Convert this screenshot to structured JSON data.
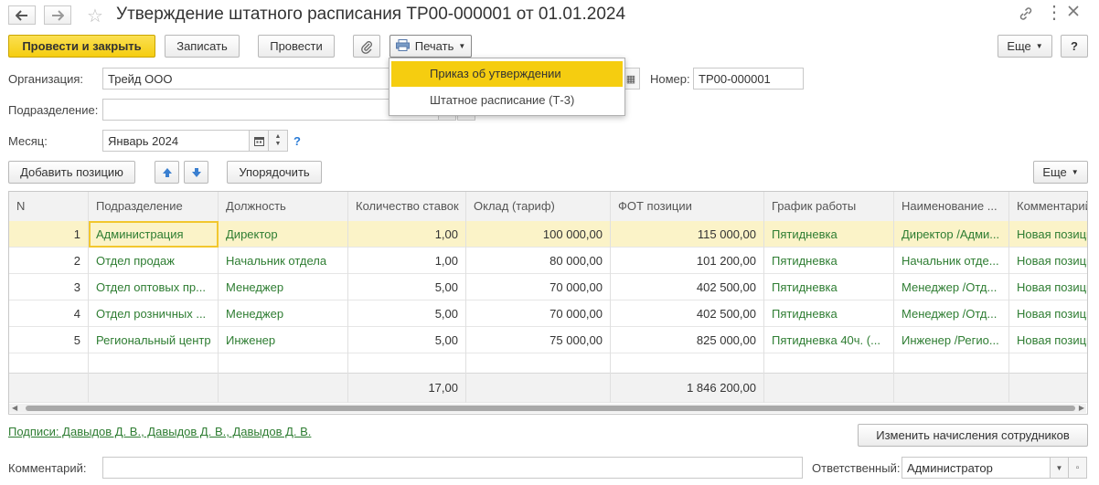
{
  "window": {
    "title": "Утверждение штатного расписания ТР00-000001 от 01.01.2024"
  },
  "toolbar": {
    "post_close": "Провести и закрыть",
    "save": "Записать",
    "post": "Провести",
    "print": "Печать",
    "more": "Еще",
    "help": "?"
  },
  "print_menu": {
    "items": [
      "Приказ об утверждении",
      "Штатное расписание (Т-3)"
    ],
    "active_index": 0
  },
  "form": {
    "org_label": "Организация:",
    "org_value": "Трейд ООО",
    "number_label": "Номер:",
    "number_value": "ТР00-000001",
    "dept_label": "Подразделение:",
    "dept_value": "",
    "month_label": "Месяц:",
    "month_value": "Январь 2024",
    "help_mark": "?"
  },
  "table_toolbar": {
    "add": "Добавить позицию",
    "sort": "Упорядочить",
    "more": "Еще"
  },
  "table": {
    "columns": [
      "N",
      "Подразделение",
      "Должность",
      "Количество ставок",
      "Оклад (тариф)",
      "ФОТ  позиции",
      "График работы",
      "Наименование ...",
      "Комментарий"
    ],
    "rows": [
      [
        "1",
        "Администрация",
        "Директор",
        "1,00",
        "100 000,00",
        "115 000,00",
        "Пятидневка",
        "Директор /Адми...",
        "Новая позиция"
      ],
      [
        "2",
        "Отдел продаж",
        "Начальник отдела",
        "1,00",
        "80 000,00",
        "101 200,00",
        "Пятидневка",
        "Начальник отде...",
        "Новая позиция"
      ],
      [
        "3",
        "Отдел оптовых пр...",
        "Менеджер",
        "5,00",
        "70 000,00",
        "402 500,00",
        "Пятидневка",
        "Менеджер /Отд...",
        "Новая позиция"
      ],
      [
        "4",
        "Отдел розничных ...",
        "Менеджер",
        "5,00",
        "70 000,00",
        "402 500,00",
        "Пятидневка",
        "Менеджер /Отд...",
        "Новая позиция"
      ],
      [
        "5",
        "Региональный центр",
        "Инженер",
        "5,00",
        "75 000,00",
        "825 000,00",
        "Пятидневка 40ч. (...",
        "Инженер /Регио...",
        "Новая позиция"
      ]
    ],
    "totals": {
      "rates": "17,00",
      "fot": "1 846 200,00"
    }
  },
  "bottom": {
    "signatures_link": "Подписи: Давыдов Д. В., Давыдов Д. В., Давыдов Д. В.",
    "change_accruals": "Изменить начисления сотрудников",
    "comment_label": "Комментарий:",
    "comment_value": "",
    "responsible_label": "Ответственный:",
    "responsible_value": "Администратор"
  },
  "colors": {
    "accent_yellow": "#f5cd10",
    "selected_row": "#fbf3c8",
    "link_green": "#2e7d32"
  }
}
